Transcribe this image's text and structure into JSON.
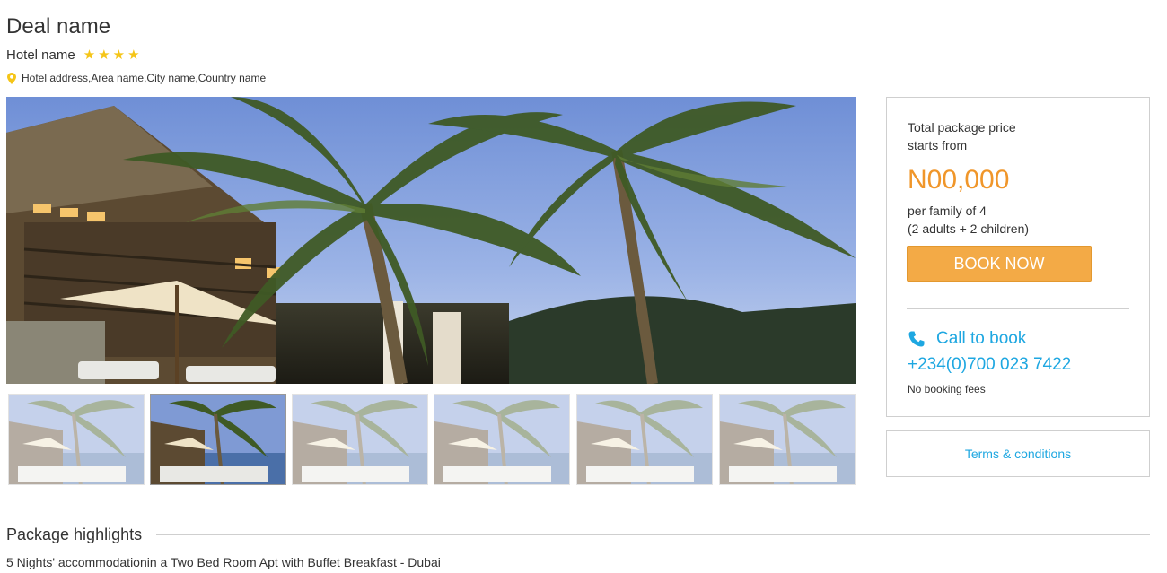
{
  "deal": {
    "title": "Deal name",
    "hotel_name": "Hotel name",
    "star_rating": 4,
    "address": "Hotel address,Area name,City name,Country name"
  },
  "gallery": {
    "thumbnail_count": 6,
    "active_index": 1
  },
  "pricing": {
    "label_line1": "Total package price",
    "label_line2": "starts from",
    "price": "N00,000",
    "per_line1": "per family of 4",
    "per_line2": "(2 adults + 2 children)",
    "book_label": "BOOK NOW",
    "call_label": "Call to book",
    "phone": "+234(0)700 023 7422",
    "fees_note": "No booking fees",
    "accent_color": "#f0962a",
    "link_color": "#1ea7e1"
  },
  "terms": {
    "label": "Terms & conditions"
  },
  "highlights": {
    "title": "Package highlights",
    "items": [
      "5 Nights' accommodationin a Two Bed Room Apt with Buffet Breakfast - Dubai"
    ]
  }
}
